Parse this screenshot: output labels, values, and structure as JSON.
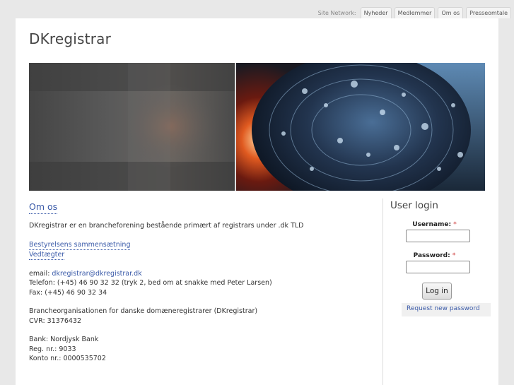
{
  "network": {
    "label": "Site Network:",
    "tabs": [
      "Nyheder",
      "Medlemmer",
      "Om os",
      "Presseomtale"
    ]
  },
  "site": {
    "title": "DKregistrar"
  },
  "main": {
    "heading": "Om os",
    "intro": "DKregistrar er en brancheforening bestående primært af registrars under .dk TLD",
    "links": [
      "Bestyrelsens sammensætning",
      "Vedtægter"
    ],
    "contact": {
      "email_prefix": "email: ",
      "email": "dkregistrar@dkregistrar.dk",
      "phone": "Telefon: (+45) 46 90 32 32 (tryk 2, bed om at snakke med Peter Larsen)",
      "fax": "Fax: (+45) 46 90 32 34"
    },
    "org": {
      "name": "Brancheorganisationen for danske domæneregistrarer (DKregistrar)",
      "cvr": "CVR: 31376432"
    },
    "bank": {
      "name": "Bank: Nordjysk Bank",
      "reg": "Reg. nr.: 9033",
      "account": "Konto nr.: 0000535702"
    }
  },
  "login": {
    "title": "User login",
    "username_label": "Username:",
    "password_label": "Password:",
    "required_mark": "*",
    "button": "Log in",
    "request_link": "Request new password"
  },
  "colors": {
    "link": "#3a5aa8",
    "background": "#e8e8e8",
    "required": "#cc3333"
  }
}
